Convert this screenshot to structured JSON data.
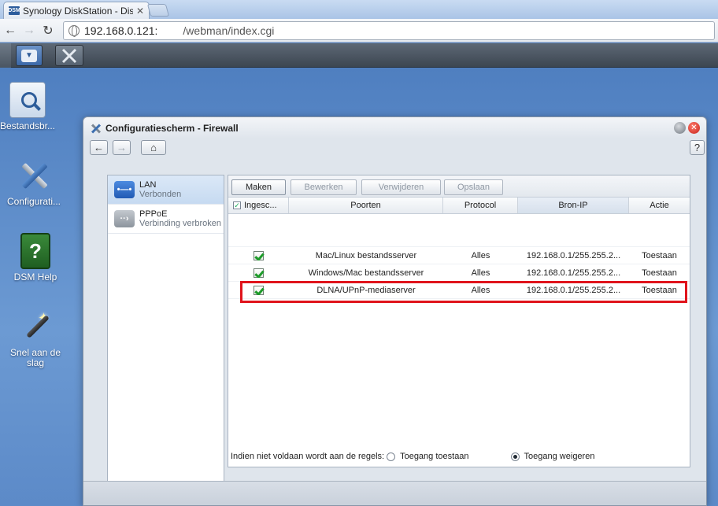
{
  "browser": {
    "tab_title": "Synology DiskStation - Disk",
    "tab_favicon": "DSM",
    "url_host": "192.168.0.121:",
    "url_path": "/webman/index.cgi"
  },
  "desktop": {
    "icons": [
      {
        "label": "Bestandsbr...",
        "icon": "folder-search-icon"
      },
      {
        "label": "Configurati...",
        "icon": "tools-icon"
      },
      {
        "label": "DSM Help",
        "icon": "help-book-icon"
      },
      {
        "label": "Snel aan de slag",
        "icon": "magic-wand-icon"
      }
    ]
  },
  "window": {
    "title": "Configuratiescherm - Firewall",
    "help_label": "?",
    "sidebar": [
      {
        "name": "LAN",
        "status": "Verbonden",
        "selected": true
      },
      {
        "name": "PPPoE",
        "status": "Verbinding verbroken",
        "selected": false
      }
    ],
    "toolbar": {
      "create": "Maken",
      "edit": "Bewerken",
      "delete": "Verwijderen",
      "save": "Opslaan"
    },
    "columns": {
      "enabled": "Ingesc...",
      "ports": "Poorten",
      "protocol": "Protocol",
      "source_ip": "Bron-IP",
      "action": "Actie"
    },
    "rules": [
      {
        "enabled": true,
        "ports": "Mac/Linux bestandsserver",
        "protocol": "Alles",
        "source_ip": "192.168.0.1/255.255.2...",
        "action": "Toestaan"
      },
      {
        "enabled": true,
        "ports": "Windows/Mac bestandsserver",
        "protocol": "Alles",
        "source_ip": "192.168.0.1/255.255.2...",
        "action": "Toestaan"
      },
      {
        "enabled": true,
        "ports": "DLNA/UPnP-mediaserver",
        "protocol": "Alles",
        "source_ip": "192.168.0.1/255.255.2...",
        "action": "Toestaan"
      }
    ],
    "policy": {
      "label": "Indien niet voldaan wordt aan de regels:",
      "allow": "Toegang toestaan",
      "deny": "Toegang weigeren",
      "selected": "deny"
    }
  },
  "colors": {
    "desktop": "#5b88c4",
    "highlight": "#e0141c",
    "check": "#1d9b2a"
  }
}
